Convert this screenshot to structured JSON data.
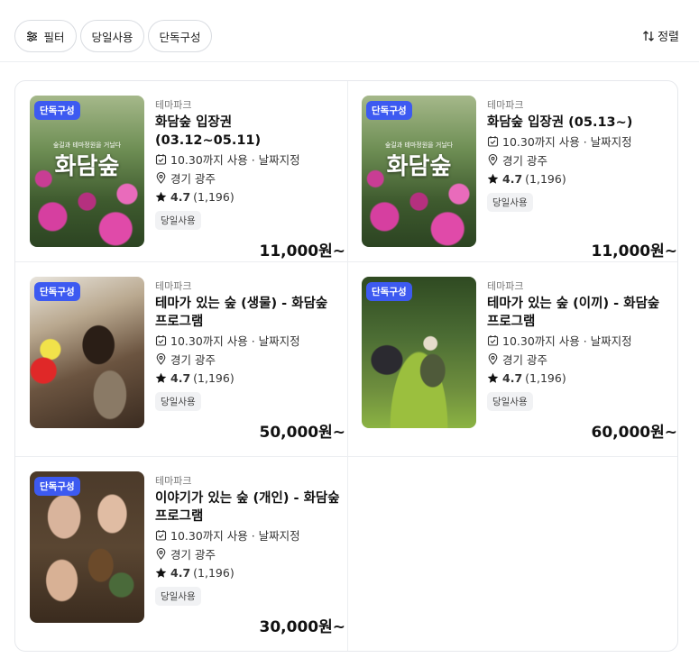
{
  "toolbar": {
    "filter_label": "필터",
    "chips": [
      "당일사용",
      "단독구성"
    ],
    "sort_label": "정렬"
  },
  "products": [
    {
      "badge": "단독구성",
      "thumb_text": "화담숲",
      "thumb_sub": "숲길과 테마정원을 거닐다",
      "category": "테마파크",
      "title": "화담숲 입장권 (03.12~05.11)",
      "usage": "10.30까지 사용 · 날짜지정",
      "location": "경기 광주",
      "rating": "4.7",
      "reviews": "(1,196)",
      "tag": "당일사용",
      "price": "11,000원~"
    },
    {
      "badge": "단독구성",
      "thumb_text": "화담숲",
      "thumb_sub": "숲길과 테마정원을 거닐다",
      "category": "테마파크",
      "title": "화담숲 입장권 (05.13~)",
      "usage": "10.30까지 사용 · 날짜지정",
      "location": "경기 광주",
      "rating": "4.7",
      "reviews": "(1,196)",
      "tag": "당일사용",
      "price": "11,000원~"
    },
    {
      "badge": "단독구성",
      "category": "테마파크",
      "title": "테마가 있는 숲 (생물) - 화담숲 프로그램",
      "usage": "10.30까지 사용 · 날짜지정",
      "location": "경기 광주",
      "rating": "4.7",
      "reviews": "(1,196)",
      "tag": "당일사용",
      "price": "50,000원~"
    },
    {
      "badge": "단독구성",
      "category": "테마파크",
      "title": "테마가 있는 숲 (이끼) - 화담숲 프로그램",
      "usage": "10.30까지 사용 · 날짜지정",
      "location": "경기 광주",
      "rating": "4.7",
      "reviews": "(1,196)",
      "tag": "당일사용",
      "price": "60,000원~"
    },
    {
      "badge": "단독구성",
      "category": "테마파크",
      "title": "이야기가 있는 숲 (개인) - 화담숲 프로그램",
      "usage": "10.30까지 사용 · 날짜지정",
      "location": "경기 광주",
      "rating": "4.7",
      "reviews": "(1,196)",
      "tag": "당일사용",
      "price": "30,000원~"
    }
  ]
}
